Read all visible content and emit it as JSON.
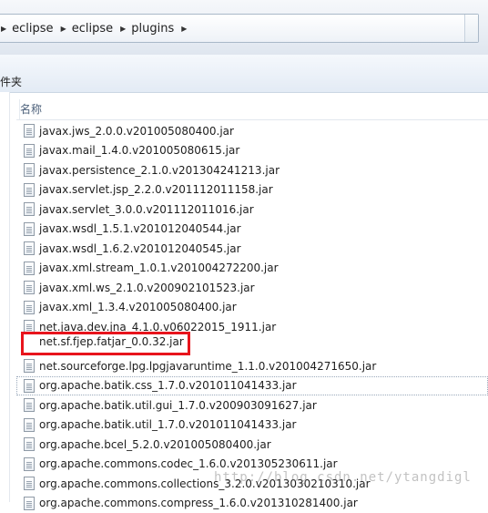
{
  "breadcrumb": [
    "eclipse",
    "eclipse",
    "plugins"
  ],
  "toolbar": {
    "label": "件夹"
  },
  "column_header": {
    "name": "名称"
  },
  "files": [
    "javax.jws_2.0.0.v201005080400.jar",
    "javax.mail_1.4.0.v201005080615.jar",
    "javax.persistence_2.1.0.v201304241213.jar",
    "javax.servlet.jsp_2.2.0.v201112011158.jar",
    "javax.servlet_3.0.0.v201112011016.jar",
    "javax.wsdl_1.5.1.v201012040544.jar",
    "javax.wsdl_1.6.2.v201012040545.jar",
    "javax.xml.stream_1.0.1.v201004272200.jar",
    "javax.xml.ws_2.1.0.v200902101523.jar",
    "javax.xml_1.3.4.v201005080400.jar",
    "net.java.dev.jna_4.1.0.v06022015_1911.jar",
    "net.sf.fjep.fatjar_0.0.32.jar",
    "net.sourceforge.lpg.lpgjavaruntime_1.1.0.v201004271650.jar",
    "org.apache.batik.css_1.7.0.v201011041433.jar",
    "org.apache.batik.util.gui_1.7.0.v200903091627.jar",
    "org.apache.batik.util_1.7.0.v201011041433.jar",
    "org.apache.bcel_5.2.0.v201005080400.jar",
    "org.apache.commons.codec_1.6.0.v201305230611.jar",
    "org.apache.commons.collections_3.2.0.v2013030210310.jar",
    "org.apache.commons.compress_1.6.0.v201310281400.jar"
  ],
  "highlighted_file": "net.sf.fjep.fatjar_0.0.32.jar",
  "selected_file": "org.apache.batik.css_1.7.0.v201011041433.jar",
  "watermark": "http://blog.csdn.net/ytangdigl"
}
